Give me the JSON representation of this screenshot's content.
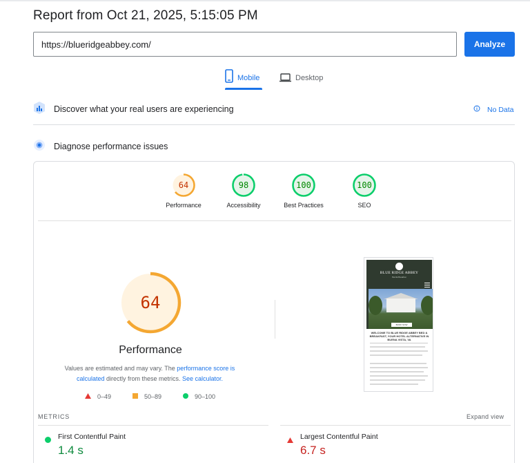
{
  "report": {
    "title": "Report from Oct 21, 2025, 5:15:05 PM"
  },
  "search": {
    "url": "https://blueridgeabbey.com/",
    "analyze_label": "Analyze"
  },
  "tabs": [
    {
      "label": "Mobile",
      "icon": "smartphone-icon",
      "selected": true
    },
    {
      "label": "Desktop",
      "icon": "laptop-icon",
      "selected": false
    }
  ],
  "sections": {
    "real_users": {
      "title": "Discover what your real users are experiencing",
      "icon": "crux-icon",
      "status": "No Data",
      "status_icon": "info-icon"
    },
    "diagnose": {
      "title": "Diagnose performance issues",
      "icon": "lighthouse-icon"
    }
  },
  "categories": [
    {
      "label": "Performance",
      "score": "64",
      "status": "average"
    },
    {
      "label": "Accessibility",
      "score": "98",
      "status": "pass"
    },
    {
      "label": "Best Practices",
      "score": "100",
      "status": "pass"
    },
    {
      "label": "SEO",
      "score": "100",
      "status": "pass"
    }
  ],
  "performance": {
    "score": "64",
    "label": "Performance",
    "disclaimer_prefix": "Values are estimated and may vary. The ",
    "disclaimer_link1": "performance score is calculated",
    "disclaimer_mid": " directly from these metrics. ",
    "disclaimer_link2": "See calculator.",
    "legend": [
      {
        "range": "0–49",
        "shape": "triangle",
        "color": "#e53935"
      },
      {
        "range": "50–89",
        "shape": "square",
        "color": "#f4a732"
      },
      {
        "range": "90–100",
        "shape": "circle",
        "color": "#0cce6b"
      }
    ]
  },
  "screenshot": {
    "site_name": "BLUE RIDGE ABBEY",
    "site_sub": "Bed & Breakfast",
    "button": "BOOK NOW",
    "heading": "WELCOME TO BLUE RIDGE ABBEY BED & BREAKFAST, YOUR HOTEL ALTERNATIVE IN BUENA VISTA, VA"
  },
  "metrics": {
    "header": "METRICS",
    "expand": "Expand view",
    "items": [
      {
        "name": "First Contentful Paint",
        "value": "1.4 s",
        "status": "pass",
        "color": "#0d8a3d"
      },
      {
        "name": "Largest Contentful Paint",
        "value": "6.7 s",
        "status": "fail",
        "color": "#c5221f"
      }
    ]
  },
  "colors": {
    "accent": "#1a73e8",
    "average": "#f4a732",
    "average_text": "#c33300",
    "pass": "#0cce6b",
    "pass_text": "#008800",
    "fail": "#e53935"
  }
}
